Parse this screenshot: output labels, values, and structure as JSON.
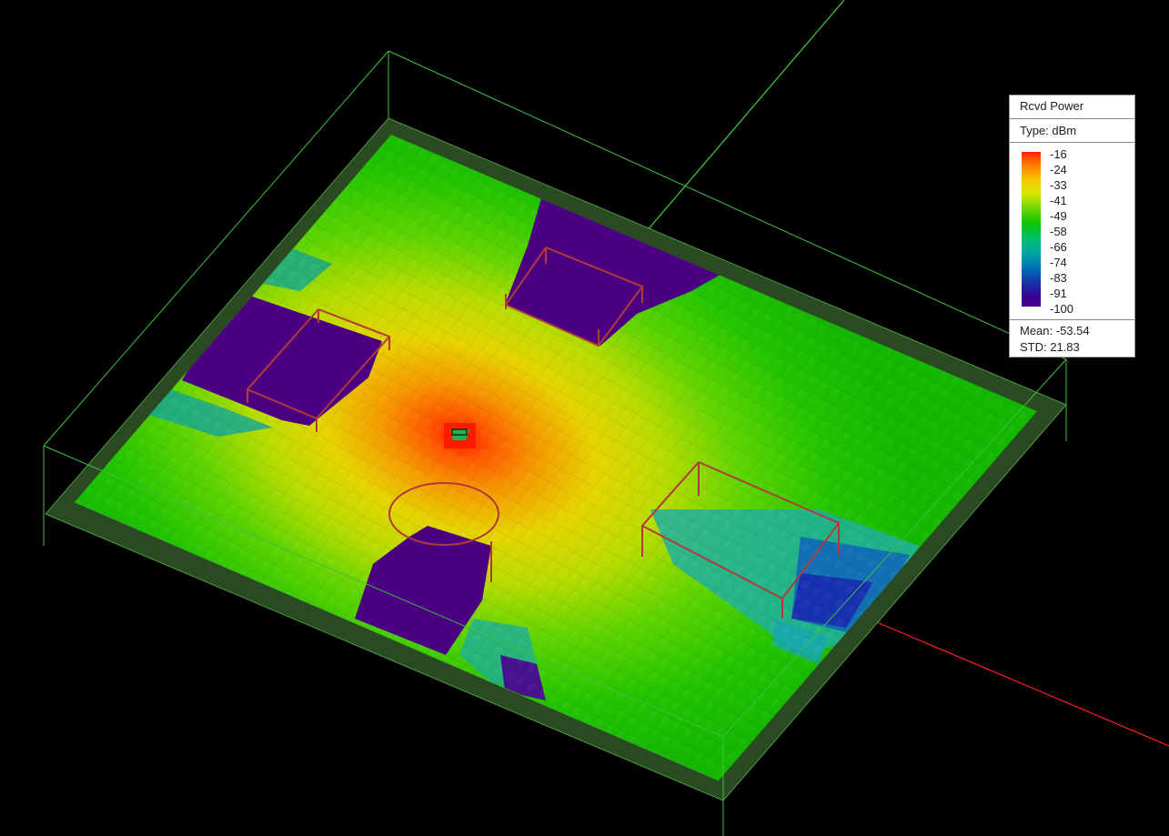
{
  "legend": {
    "title": "Rcvd Power",
    "type_label": "Type: dBm",
    "ticks": [
      "-16",
      "-24",
      "-33",
      "-41",
      "-49",
      "-58",
      "-66",
      "-74",
      "-83",
      "-91",
      "-100"
    ],
    "mean_label": "Mean: -53.54",
    "std_label": "STD: 21.83"
  },
  "colors": {
    "background": "#000000",
    "wireframe": "#3fbf3f",
    "floor_border": "#2a4a22",
    "obstacle": "#4b0082",
    "fixture_outline": "#b03030",
    "axis_x": "#ff2020",
    "axis_y": "#40d040"
  },
  "icons": {
    "transmitter": "transmitter-icon"
  }
}
